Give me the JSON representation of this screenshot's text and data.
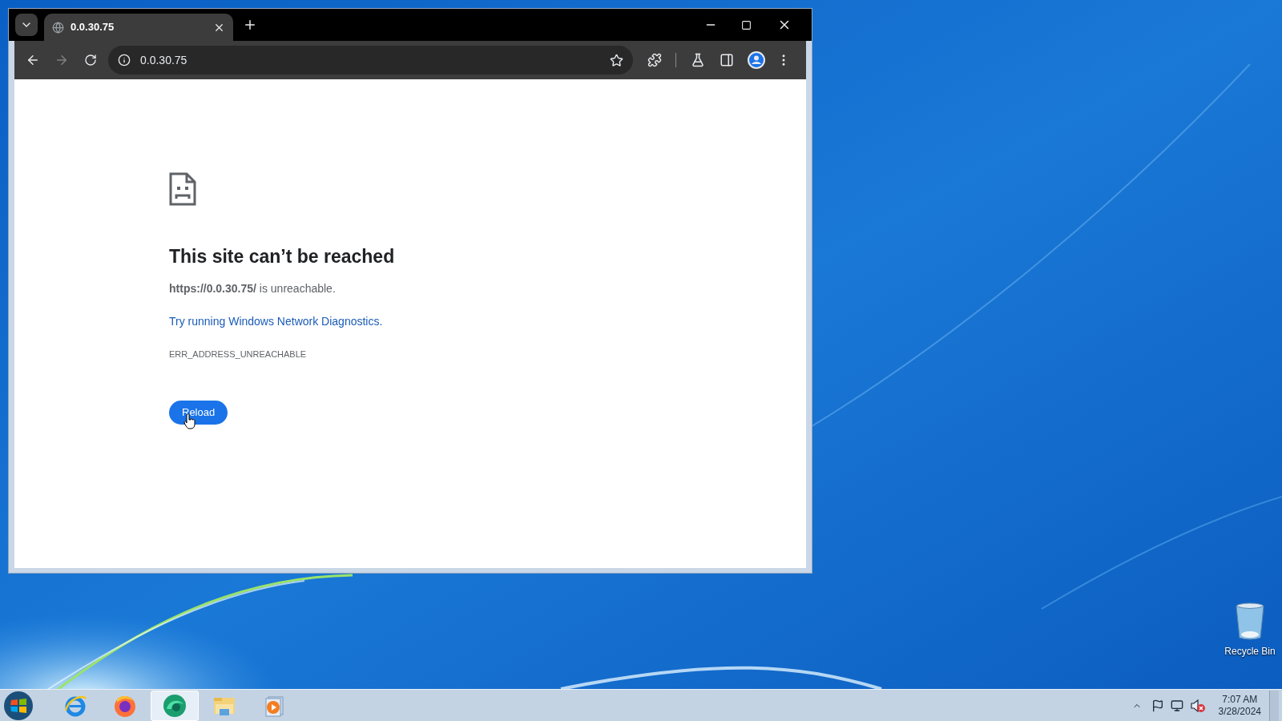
{
  "browser": {
    "tabs": [
      {
        "title": "0.0.30.75",
        "selected": true
      }
    ],
    "address_bar": {
      "value": "0.0.30.75"
    },
    "error_page": {
      "heading": "This site can’t be reached",
      "message": "**https://0.0.30.75/** is unreachable.",
      "diagnostics_link": "Try running Windows Network Diagnostics.",
      "error_code": "ERR_ADDRESS_UNREACHABLE",
      "reload_button": "Reload"
    }
  },
  "desktop": {
    "icons": [
      {
        "label": "Recycle Bin"
      }
    ]
  },
  "taskbar": {
    "apps": [
      {
        "kind": "ie",
        "selected": false
      },
      {
        "kind": "firefox",
        "selected": false
      },
      {
        "kind": "edge",
        "selected": true
      },
      {
        "kind": "explorer",
        "selected": false
      },
      {
        "kind": "media",
        "selected": false
      }
    ],
    "clock": {
      "time": "7:07 AM",
      "date": "3/28/2024"
    }
  }
}
